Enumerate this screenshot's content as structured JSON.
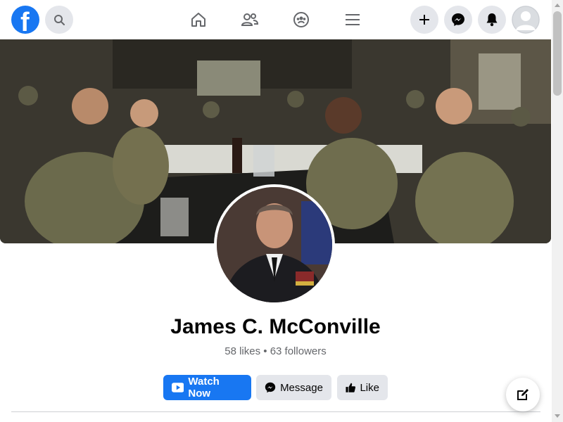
{
  "nav": {
    "logo_letter": "f",
    "logo_icon": "facebook-logo-icon",
    "search_icon": "search-icon",
    "tabs": [
      {
        "name": "home",
        "icon": "home-icon"
      },
      {
        "name": "friends",
        "icon": "friends-icon"
      },
      {
        "name": "groups",
        "icon": "groups-icon"
      },
      {
        "name": "menu",
        "icon": "hamburger-menu-icon"
      }
    ],
    "right_buttons": [
      {
        "name": "create",
        "icon": "plus-icon"
      },
      {
        "name": "messenger",
        "icon": "messenger-icon"
      },
      {
        "name": "notifications",
        "icon": "bell-icon"
      },
      {
        "name": "account",
        "icon": "avatar-icon"
      }
    ]
  },
  "profile": {
    "name": "James C. McConville",
    "stats": "58 likes • 63 followers"
  },
  "actions": {
    "watch_now": "Watch Now",
    "message": "Message",
    "like": "Like"
  },
  "colors": {
    "brand": "#1877f2",
    "button_gray": "#e4e6eb",
    "text_secondary": "#65676b"
  }
}
